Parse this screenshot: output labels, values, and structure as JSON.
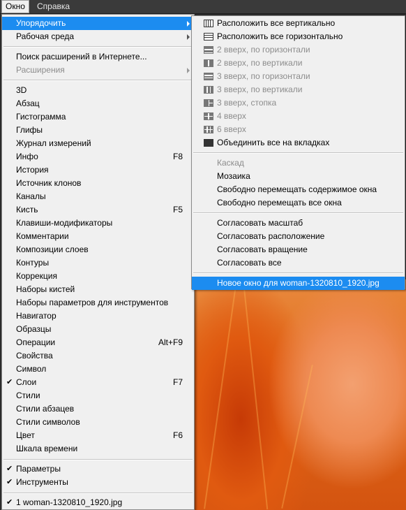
{
  "menubar": {
    "items": [
      {
        "label": "Окно"
      },
      {
        "label": "Справка"
      }
    ]
  },
  "main_menu": {
    "top_items": [
      {
        "label": "Упорядочить"
      },
      {
        "label": "Рабочая среда"
      }
    ],
    "ext_items": [
      {
        "label": "Поиск расширений в Интернете..."
      },
      {
        "label": "Расширения"
      }
    ],
    "panels": [
      {
        "label": "3D",
        "shortcut": "",
        "checked": false
      },
      {
        "label": "Абзац",
        "shortcut": "",
        "checked": false
      },
      {
        "label": "Гистограмма",
        "shortcut": "",
        "checked": false
      },
      {
        "label": "Глифы",
        "shortcut": "",
        "checked": false
      },
      {
        "label": "Журнал измерений",
        "shortcut": "",
        "checked": false
      },
      {
        "label": "Инфо",
        "shortcut": "F8",
        "checked": false
      },
      {
        "label": "История",
        "shortcut": "",
        "checked": false
      },
      {
        "label": "Источник клонов",
        "shortcut": "",
        "checked": false
      },
      {
        "label": "Каналы",
        "shortcut": "",
        "checked": false
      },
      {
        "label": "Кисть",
        "shortcut": "F5",
        "checked": false
      },
      {
        "label": "Клавиши-модификаторы",
        "shortcut": "",
        "checked": false
      },
      {
        "label": "Комментарии",
        "shortcut": "",
        "checked": false
      },
      {
        "label": "Композиции слоев",
        "shortcut": "",
        "checked": false
      },
      {
        "label": "Контуры",
        "shortcut": "",
        "checked": false
      },
      {
        "label": "Коррекция",
        "shortcut": "",
        "checked": false
      },
      {
        "label": "Наборы кистей",
        "shortcut": "",
        "checked": false
      },
      {
        "label": "Наборы параметров для инструментов",
        "shortcut": "",
        "checked": false
      },
      {
        "label": "Навигатор",
        "shortcut": "",
        "checked": false
      },
      {
        "label": "Образцы",
        "shortcut": "",
        "checked": false
      },
      {
        "label": "Операции",
        "shortcut": "Alt+F9",
        "checked": false
      },
      {
        "label": "Свойства",
        "shortcut": "",
        "checked": false
      },
      {
        "label": "Символ",
        "shortcut": "",
        "checked": false
      },
      {
        "label": "Слои",
        "shortcut": "F7",
        "checked": true
      },
      {
        "label": "Стили",
        "shortcut": "",
        "checked": false
      },
      {
        "label": "Стили абзацев",
        "shortcut": "",
        "checked": false
      },
      {
        "label": "Стили символов",
        "shortcut": "",
        "checked": false
      },
      {
        "label": "Цвет",
        "shortcut": "F6",
        "checked": false
      },
      {
        "label": "Шкала времени",
        "shortcut": "",
        "checked": false
      }
    ],
    "options": [
      {
        "label": "Параметры",
        "checked": true
      },
      {
        "label": "Инструменты",
        "checked": true
      }
    ],
    "documents": [
      {
        "label": "1 woman-1320810_1920.jpg",
        "checked": true
      }
    ],
    "check_glyph": "✔"
  },
  "sub_menu": {
    "arrange": [
      {
        "label": "Расположить все вертикально",
        "icon": "tile-vertical-icon",
        "enabled": true
      },
      {
        "label": "Расположить все горизонтально",
        "icon": "tile-horizontal-icon",
        "enabled": true
      },
      {
        "label": "2 вверх, по горизонтали",
        "icon": "two-up-horizontal-icon",
        "enabled": false
      },
      {
        "label": "2 вверх, по вертикали",
        "icon": "two-up-vertical-icon",
        "enabled": false
      },
      {
        "label": "3 вверх, по горизонтали",
        "icon": "three-up-horizontal-icon",
        "enabled": false
      },
      {
        "label": "3 вверх, по вертикали",
        "icon": "three-up-vertical-icon",
        "enabled": false
      },
      {
        "label": "3 вверх, стопка",
        "icon": "three-up-stacked-icon",
        "enabled": false
      },
      {
        "label": "4 вверх",
        "icon": "four-up-icon",
        "enabled": false
      },
      {
        "label": "6 вверх",
        "icon": "six-up-icon",
        "enabled": false
      },
      {
        "label": "Объединить все на вкладках",
        "icon": "consolidate-tabs-icon",
        "enabled": true
      }
    ],
    "windows": [
      {
        "label": "Каскад",
        "enabled": false
      },
      {
        "label": "Мозаика",
        "enabled": true
      },
      {
        "label": "Свободно перемещать содержимое окна",
        "enabled": true
      },
      {
        "label": "Свободно перемещать все окна",
        "enabled": true
      }
    ],
    "match": [
      {
        "label": "Согласовать масштаб"
      },
      {
        "label": "Согласовать расположение"
      },
      {
        "label": "Согласовать вращение"
      },
      {
        "label": "Согласовать все"
      }
    ],
    "new_window": {
      "label": "Новое окно для woman-1320810_1920.jpg"
    }
  },
  "colors": {
    "highlight": "#1c8cf0",
    "menu_bg": "#f0f0f0",
    "disabled_text": "#8c8c8c",
    "menubar_bg": "#3a3a3a"
  }
}
